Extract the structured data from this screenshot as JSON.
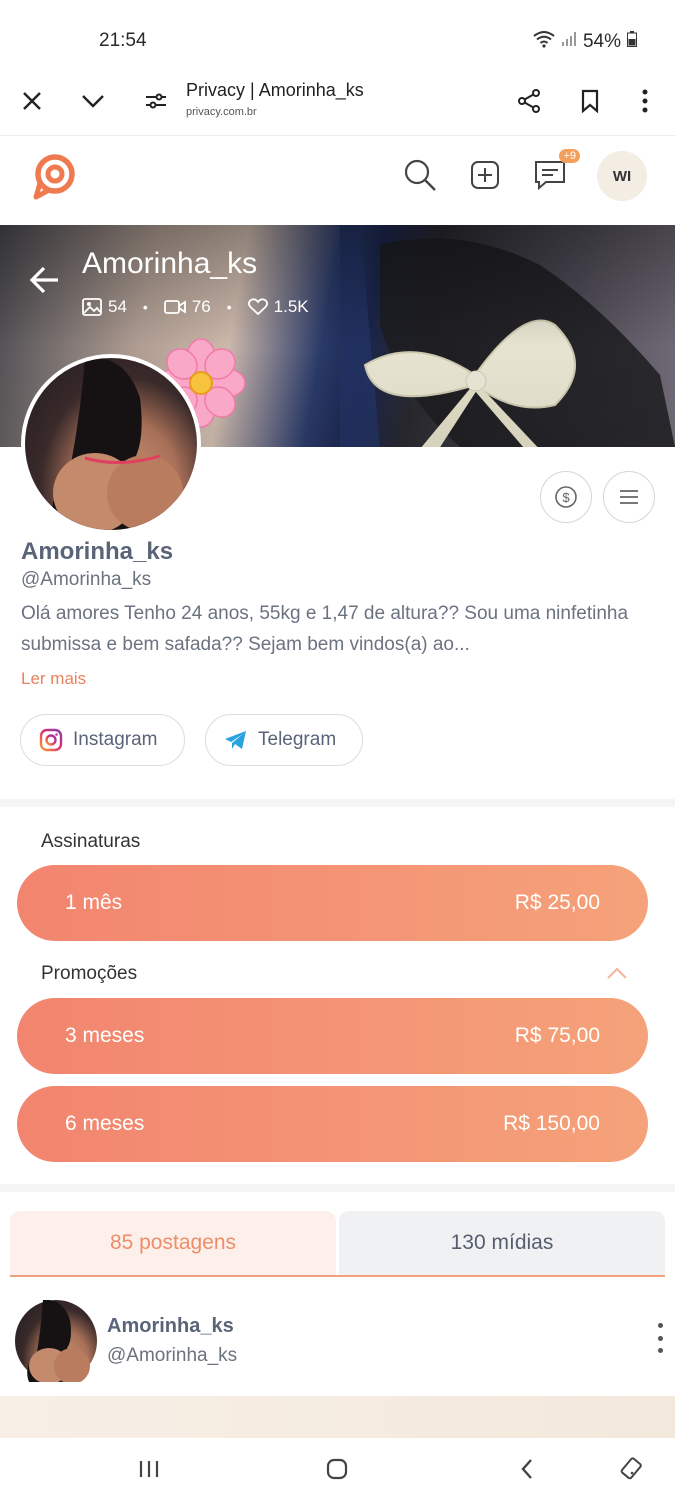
{
  "status_bar": {
    "time": "21:54",
    "battery": "54%"
  },
  "browser": {
    "title": "Privacy | Amorinha_ks",
    "url": "privacy.com.br"
  },
  "site_header": {
    "messages_badge": "+9",
    "user_initials": "WI"
  },
  "cover": {
    "name": "Amorinha_ks",
    "photos_count": "54",
    "videos_count": "76",
    "likes_count": "1.5K"
  },
  "profile": {
    "name": "Amorinha_ks",
    "handle": "@Amorinha_ks",
    "bio": "Olá amores Tenho 24 anos, 55kg e 1,47 de altura?? Sou uma ninfetinha submissa e bem safada?? Sejam bem vindos(a) ao...",
    "read_more": "Ler mais",
    "social": [
      {
        "label": "Instagram",
        "icon": "instagram-icon"
      },
      {
        "label": "Telegram",
        "icon": "telegram-icon"
      }
    ]
  },
  "subscriptions": {
    "title": "Assinaturas",
    "plans": [
      {
        "label": "1 mês",
        "price": "R$ 25,00"
      }
    ]
  },
  "promotions": {
    "title": "Promoções",
    "plans": [
      {
        "label": "3 meses",
        "price": "R$ 75,00"
      },
      {
        "label": "6 meses",
        "price": "R$ 150,00"
      }
    ]
  },
  "tabs": [
    {
      "label": "85 postagens",
      "active": true
    },
    {
      "label": "130 mídias",
      "active": false
    }
  ],
  "post": {
    "name": "Amorinha_ks",
    "handle": "@Amorinha_ks"
  },
  "colors": {
    "accent": "#ee8d6a",
    "plan_start": "#f2856f",
    "plan_end": "#f5a27a"
  }
}
